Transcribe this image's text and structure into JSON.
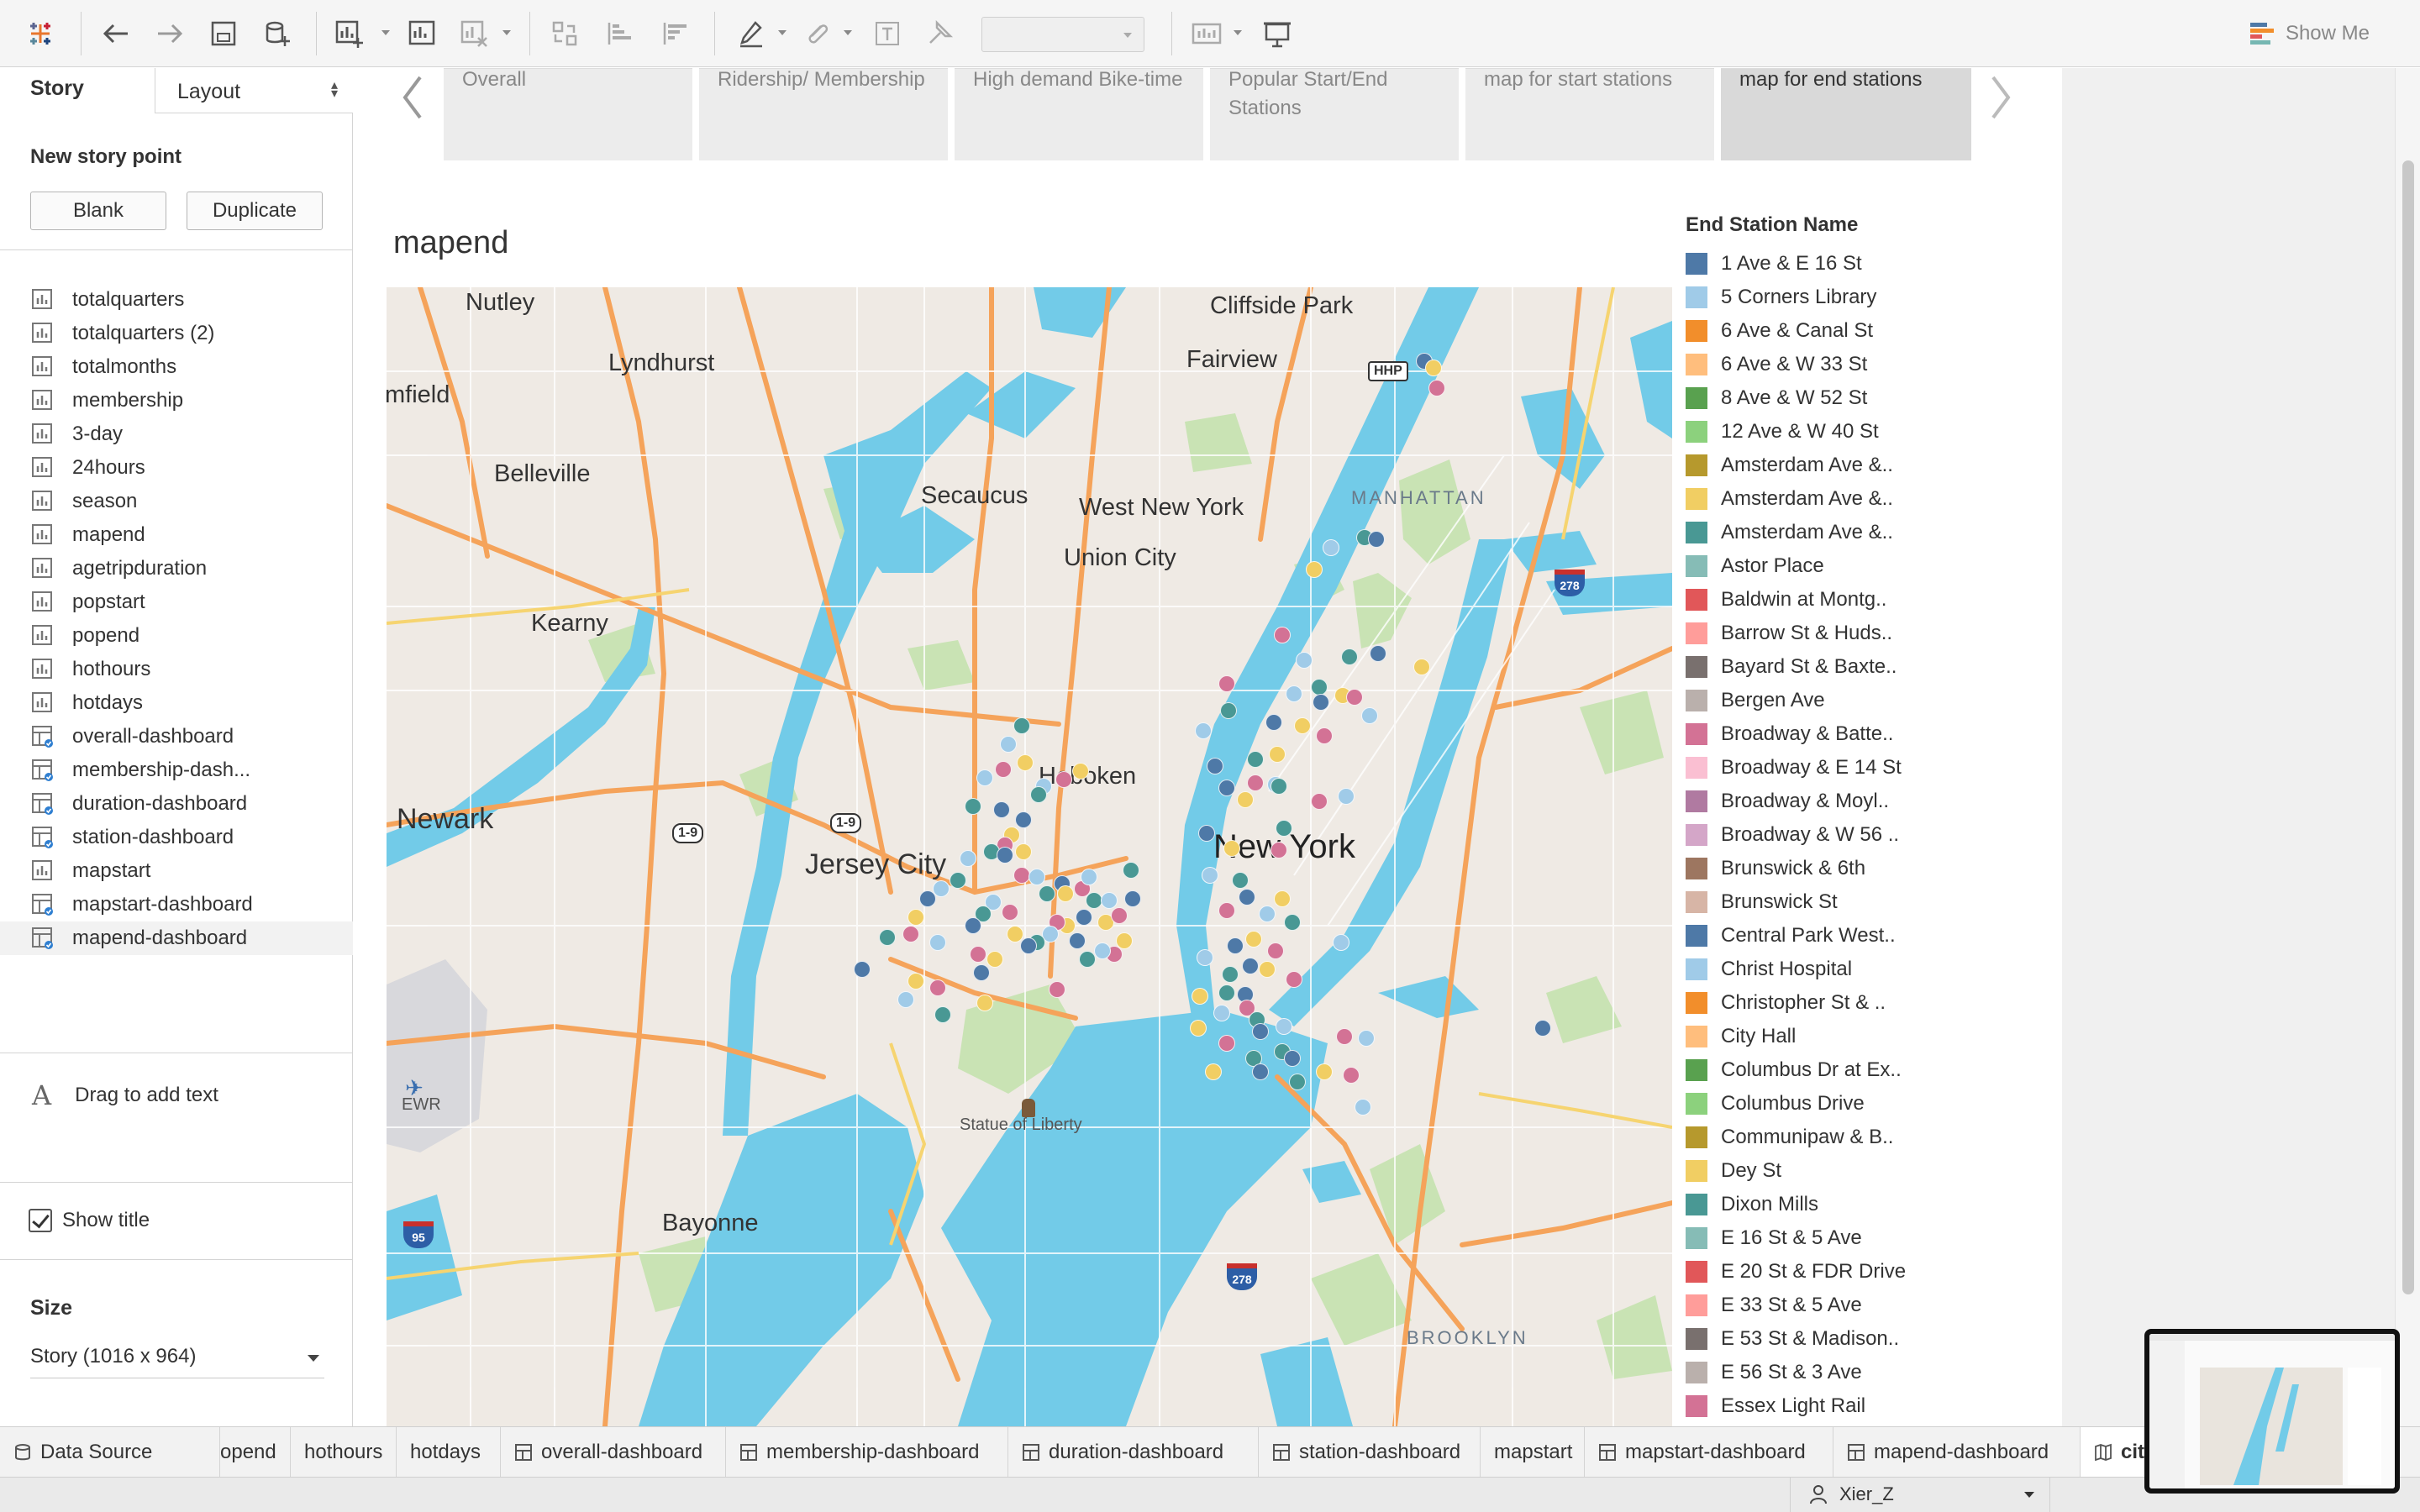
{
  "app": {
    "title": "Tableau"
  },
  "toolbar": {
    "buttons": [
      "tableau-logo-icon",
      "undo-icon",
      "redo-icon",
      "save-icon",
      "new-data-source-icon",
      "new-worksheet-icon",
      "new-dashboard-icon",
      "clear-sheet-icon",
      "swap-icon",
      "sort-ascending-icon",
      "sort-descending-icon",
      "highlight-icon",
      "group-icon",
      "labels-icon",
      "pin-icon",
      "show-cards-icon",
      "presentation-icon"
    ],
    "fit_value": "",
    "show_me_label": "Show Me"
  },
  "left_panel": {
    "story_tab": "Story",
    "layout_tab": "Layout",
    "new_story_point": "New story point",
    "blank_button": "Blank",
    "duplicate_button": "Duplicate",
    "sheets": [
      {
        "name": "totalquarters",
        "kind": "worksheet"
      },
      {
        "name": "totalquarters (2)",
        "kind": "worksheet"
      },
      {
        "name": "totalmonths",
        "kind": "worksheet"
      },
      {
        "name": "membership",
        "kind": "worksheet"
      },
      {
        "name": "3-day",
        "kind": "worksheet"
      },
      {
        "name": "24hours",
        "kind": "worksheet"
      },
      {
        "name": "season",
        "kind": "worksheet"
      },
      {
        "name": "mapend",
        "kind": "worksheet"
      },
      {
        "name": "agetripduration",
        "kind": "worksheet"
      },
      {
        "name": "popstart",
        "kind": "worksheet"
      },
      {
        "name": "popend",
        "kind": "worksheet"
      },
      {
        "name": "hothours",
        "kind": "worksheet"
      },
      {
        "name": "hotdays",
        "kind": "worksheet"
      },
      {
        "name": "overall-dashboard",
        "kind": "dashboard"
      },
      {
        "name": "membership-dash...",
        "kind": "dashboard"
      },
      {
        "name": "duration-dashboard",
        "kind": "dashboard"
      },
      {
        "name": "station-dashboard",
        "kind": "dashboard"
      },
      {
        "name": "mapstart",
        "kind": "worksheet"
      },
      {
        "name": "mapstart-dashboard",
        "kind": "dashboard"
      },
      {
        "name": "mapend-dashboard",
        "kind": "dashboard"
      }
    ],
    "drag_text": "Drag to add text",
    "show_title": "Show title",
    "size_label": "Size",
    "size_value": "Story (1016 x 964)"
  },
  "story_points": [
    {
      "label": "Overall"
    },
    {
      "label": "Ridership/ Membership"
    },
    {
      "label": "High demand Bike-time"
    },
    {
      "label": "Popular Start/End Stations"
    },
    {
      "label": "map for start stations"
    },
    {
      "label": "map for end stations"
    }
  ],
  "sheet_title": "mapend",
  "map": {
    "places": {
      "nutley": "Nutley",
      "cliffside_park": "Cliffside Park",
      "lyndhurst": "Lyndhurst",
      "fairview": "Fairview",
      "bloomfield": "mfield",
      "belleville": "Belleville",
      "secaucus": "Secaucus",
      "west_new_york": "West New York",
      "manhattan": "MANHATTAN",
      "union_city": "Union City",
      "kearny": "Kearny",
      "hoboken": "Hoboken",
      "newark": "Newark",
      "jersey_city": "Jersey City",
      "new_york": "New York",
      "ewr": "EWR",
      "statue_of_liberty": "Statue of Liberty",
      "bayonne": "Bayonne",
      "brooklyn": "BROOKLYN"
    },
    "shields": {
      "hhp": "HHP",
      "us1_9_a": "1-9",
      "us1_9_b": "1-9",
      "i278_a": "278",
      "i278_b": "278",
      "i95": "95"
    }
  },
  "legend": {
    "title": "End Station Name",
    "items": [
      {
        "label": "1 Ave & E 16 St",
        "color": "#4e79a7"
      },
      {
        "label": "5 Corners Library",
        "color": "#a0cbe8"
      },
      {
        "label": "6 Ave & Canal St",
        "color": "#f28e2b"
      },
      {
        "label": "6 Ave & W 33 St",
        "color": "#ffbe7d"
      },
      {
        "label": "8 Ave & W 52 St",
        "color": "#59a14f"
      },
      {
        "label": "12 Ave & W 40 St",
        "color": "#8cd17d"
      },
      {
        "label": "Amsterdam Ave &..",
        "color": "#b6992d"
      },
      {
        "label": "Amsterdam Ave &..",
        "color": "#f1ce63"
      },
      {
        "label": "Amsterdam Ave &..",
        "color": "#499894"
      },
      {
        "label": "Astor Place",
        "color": "#86bcb6"
      },
      {
        "label": "Baldwin at Montg..",
        "color": "#e15759"
      },
      {
        "label": "Barrow St & Huds..",
        "color": "#ff9d9a"
      },
      {
        "label": "Bayard St & Baxte..",
        "color": "#79706e"
      },
      {
        "label": "Bergen Ave",
        "color": "#bab0ac"
      },
      {
        "label": "Broadway & Batte..",
        "color": "#d37295"
      },
      {
        "label": "Broadway & E 14 St",
        "color": "#fabfd2"
      },
      {
        "label": "Broadway & Moyl..",
        "color": "#b07aa1"
      },
      {
        "label": "Broadway & W 56 ..",
        "color": "#d4a6c8"
      },
      {
        "label": "Brunswick & 6th",
        "color": "#9d7660"
      },
      {
        "label": "Brunswick St",
        "color": "#d7b5a6"
      },
      {
        "label": "Central Park West..",
        "color": "#4e79a7"
      },
      {
        "label": "Christ Hospital",
        "color": "#a0cbe8"
      },
      {
        "label": "Christopher St & ..",
        "color": "#f28e2b"
      },
      {
        "label": "City Hall",
        "color": "#ffbe7d"
      },
      {
        "label": "Columbus Dr at Ex..",
        "color": "#59a14f"
      },
      {
        "label": "Columbus Drive",
        "color": "#8cd17d"
      },
      {
        "label": "Communipaw & B..",
        "color": "#b6992d"
      },
      {
        "label": "Dey St",
        "color": "#f1ce63"
      },
      {
        "label": "Dixon Mills",
        "color": "#499894"
      },
      {
        "label": "E 16 St & 5 Ave",
        "color": "#86bcb6"
      },
      {
        "label": "E 20 St & FDR Drive",
        "color": "#e15759"
      },
      {
        "label": "E 33 St & 5 Ave",
        "color": "#ff9d9a"
      },
      {
        "label": "E 53 St & Madison..",
        "color": "#79706e"
      },
      {
        "label": "E 56 St & 3 Ave",
        "color": "#bab0ac"
      },
      {
        "label": "Essex Light Rail",
        "color": "#d37295"
      }
    ]
  },
  "bottom_tabs": [
    {
      "label": "Data Source",
      "icon": "database-icon"
    },
    {
      "label": "opend",
      "icon": ""
    },
    {
      "label": "hothours",
      "icon": ""
    },
    {
      "label": "hotdays",
      "icon": ""
    },
    {
      "label": "overall-dashboard",
      "icon": "dashboard-icon"
    },
    {
      "label": "membership-dashboard",
      "icon": "dashboard-icon"
    },
    {
      "label": "duration-dashboard",
      "icon": "dashboard-icon"
    },
    {
      "label": "station-dashboard",
      "icon": "dashboard-icon"
    },
    {
      "label": "mapstart",
      "icon": ""
    },
    {
      "label": "mapstart-dashboard",
      "icon": "dashboard-icon"
    },
    {
      "label": "mapend-dashboard",
      "icon": "dashboard-icon"
    },
    {
      "label": "cit",
      "icon": "story-icon"
    }
  ],
  "status": {
    "user": "Xier_Z"
  }
}
